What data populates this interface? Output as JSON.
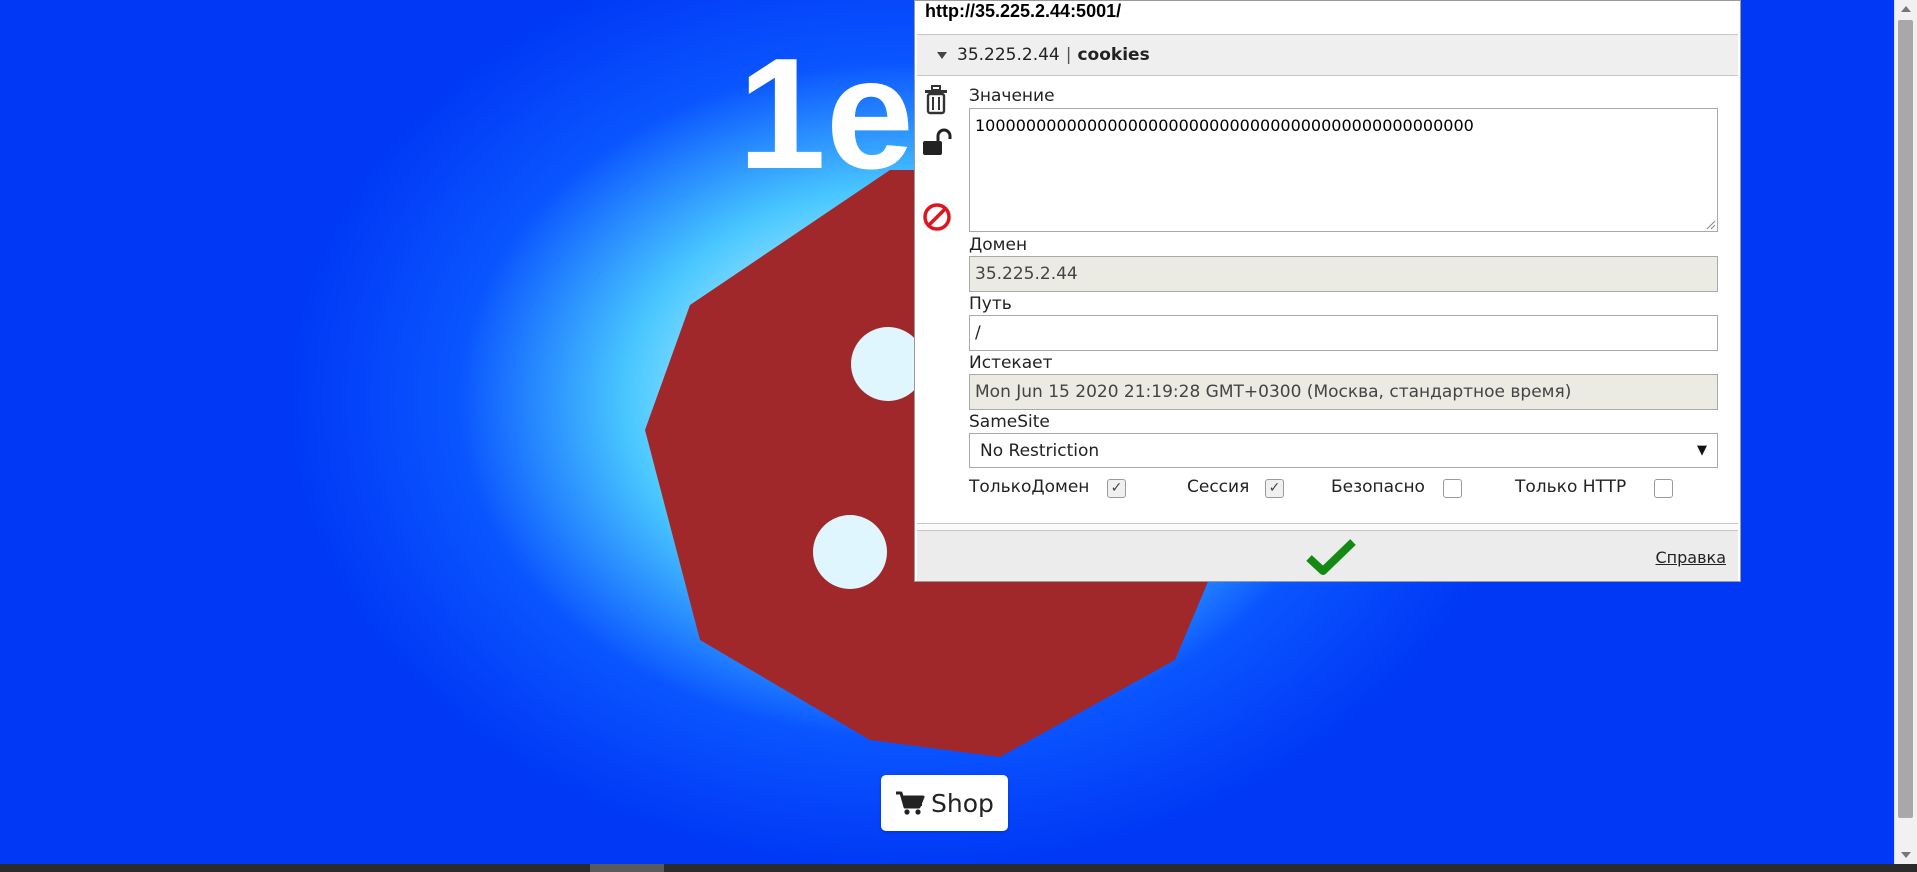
{
  "game": {
    "score": "1e",
    "shop_label": "Shop",
    "colors": {
      "background_center": "#bff0ff",
      "background_edge": "#0038f5",
      "cookie": "#a0282b",
      "chip": "#dff6ff"
    }
  },
  "editor": {
    "url": "http://35.225.2.44:5001/",
    "cookie_domain": "35.225.2.44",
    "separator": "|",
    "cookie_name": "cookies",
    "value_label": "Значение",
    "value": "1000000000000000000000000000000000000000000000000",
    "domain_label": "Домен",
    "domain": "35.225.2.44",
    "path_label": "Путь",
    "path": "/",
    "expires_label": "Истекает",
    "expires": "Mon Jun 15 2020 21:19:28 GMT+0300 (Москва, стандартное время)",
    "samesite_label": "SameSite",
    "samesite": "No Restriction",
    "flags": [
      {
        "label": "ТолькоДомен",
        "checked": true
      },
      {
        "label": "Сессия",
        "checked": true
      },
      {
        "label": "Безопасно",
        "checked": false
      },
      {
        "label": "Только HTTP",
        "checked": false
      }
    ],
    "help_label": "Справка",
    "icons": [
      "trash-icon",
      "unlock-icon",
      "block-icon",
      "checkmark-icon"
    ],
    "save_color": "#148a14",
    "block_color": "#e0141e"
  }
}
